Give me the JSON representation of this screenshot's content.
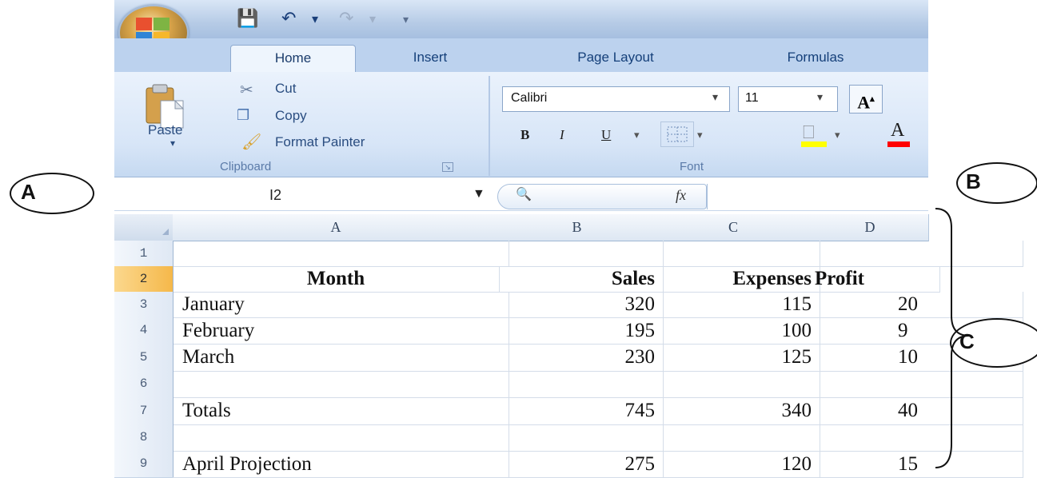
{
  "qat": {
    "save_icon": "save-icon",
    "undo_icon": "undo-icon",
    "redo_icon": "redo-icon"
  },
  "tabs": [
    {
      "label": "Home",
      "active": true
    },
    {
      "label": "Insert"
    },
    {
      "label": "Page Layout"
    },
    {
      "label": "Formulas"
    }
  ],
  "clipboard": {
    "paste_label": "Paste",
    "cut_label": "Cut",
    "copy_label": "Copy",
    "format_painter_label": "Format Painter",
    "group_label": "Clipboard"
  },
  "font": {
    "font_name": "Calibri",
    "font_size": "11",
    "bold": "B",
    "italic": "I",
    "underline": "U",
    "grow_font": "A",
    "group_label": "Font",
    "fill_color": "#ffff00",
    "font_color": "#ff0000"
  },
  "formula_bar": {
    "name_box": "I2",
    "fx_label": "fx",
    "formula": ""
  },
  "grid": {
    "columns": [
      "A",
      "B",
      "C",
      "D"
    ],
    "rows": [
      {
        "num": "1",
        "cells": [
          "",
          "",
          "",
          ""
        ]
      },
      {
        "num": "2",
        "cells": [
          "Month",
          "Sales",
          "Expenses",
          "Profit"
        ],
        "header": true,
        "selected": true
      },
      {
        "num": "3",
        "cells": [
          "January",
          "320",
          "115",
          "20"
        ]
      },
      {
        "num": "4",
        "cells": [
          "February",
          "195",
          "100",
          "9"
        ]
      },
      {
        "num": "5",
        "cells": [
          "March",
          "230",
          "125",
          "10"
        ]
      },
      {
        "num": "6",
        "cells": [
          "",
          "",
          "",
          ""
        ]
      },
      {
        "num": "7",
        "cells": [
          "Totals",
          "745",
          "340",
          "40"
        ]
      },
      {
        "num": "8",
        "cells": [
          "",
          "",
          "",
          ""
        ]
      },
      {
        "num": "9",
        "cells": [
          "April Projection",
          "275",
          "120",
          "15"
        ]
      }
    ]
  },
  "callouts": {
    "a": "A",
    "b": "B",
    "c": "C"
  }
}
